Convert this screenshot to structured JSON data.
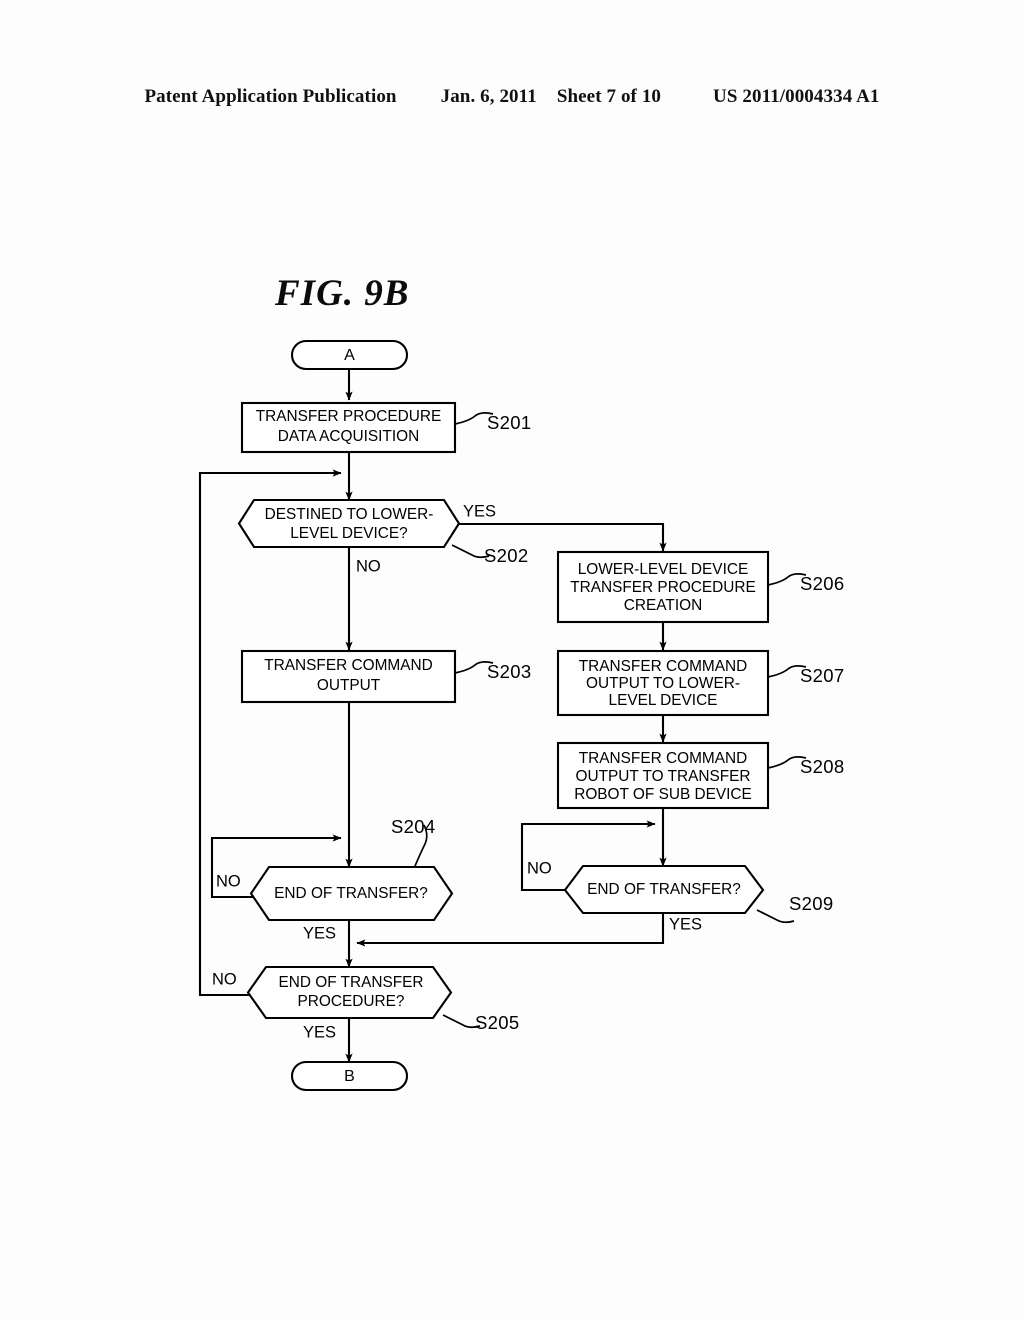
{
  "header": {
    "publication": "Patent Application Publication",
    "date": "Jan. 6, 2011",
    "sheet": "Sheet 7 of 10",
    "number": "US 2011/0004334 A1"
  },
  "figure": {
    "title": "FIG.  9B"
  },
  "terminals": {
    "start": "A",
    "end": "B"
  },
  "nodes": {
    "s201": {
      "id": "S201",
      "line1": "TRANSFER PROCEDURE",
      "line2": "DATA ACQUISITION"
    },
    "s202": {
      "id": "S202",
      "line1": "DESTINED TO LOWER-",
      "line2": "LEVEL DEVICE?",
      "yes": "YES",
      "no": "NO"
    },
    "s203": {
      "id": "S203",
      "line1": "TRANSFER COMMAND",
      "line2": "OUTPUT"
    },
    "s204": {
      "id": "S204",
      "line1": "END OF TRANSFER?",
      "yes": "YES",
      "no": "NO"
    },
    "s205": {
      "id": "S205",
      "line1": "END OF TRANSFER",
      "line2": "PROCEDURE?",
      "yes": "YES",
      "no": "NO"
    },
    "s206": {
      "id": "S206",
      "line1": "LOWER-LEVEL DEVICE",
      "line2": "TRANSFER PROCEDURE",
      "line3": "CREATION"
    },
    "s207": {
      "id": "S207",
      "line1": "TRANSFER COMMAND",
      "line2": "OUTPUT TO LOWER-",
      "line3": "LEVEL DEVICE"
    },
    "s208": {
      "id": "S208",
      "line1": "TRANSFER COMMAND",
      "line2": "OUTPUT TO TRANSFER",
      "line3": "ROBOT OF SUB DEVICE"
    },
    "s209": {
      "id": "S209",
      "line1": "END OF TRANSFER?",
      "yes": "YES",
      "no": "NO"
    }
  },
  "colors": {
    "ink": "#000000",
    "paper": "#fdfdfd"
  }
}
